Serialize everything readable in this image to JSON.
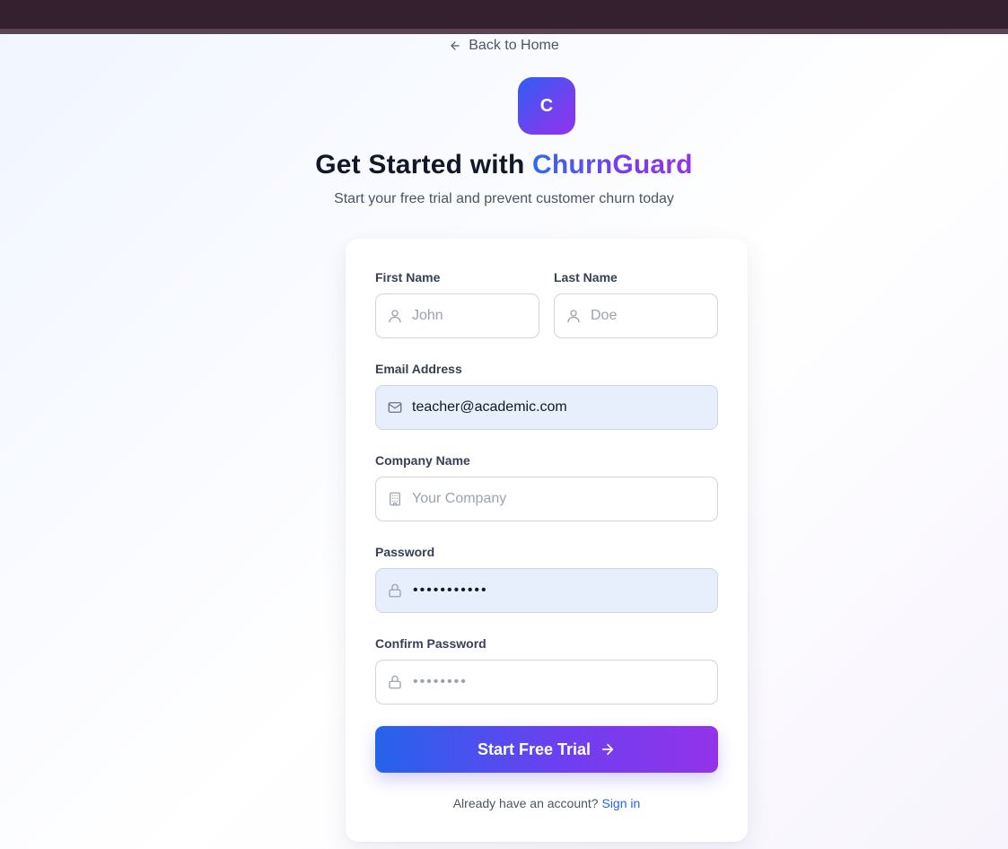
{
  "nav": {
    "back_label": "Back to Home"
  },
  "logo": {
    "letter": "C"
  },
  "header": {
    "title_prefix": "Get Started with",
    "brand": "ChurnGuard",
    "subtitle": "Start your free trial and prevent customer churn today"
  },
  "form": {
    "first_name": {
      "label": "First Name",
      "placeholder": "John",
      "value": ""
    },
    "last_name": {
      "label": "Last Name",
      "placeholder": "Doe",
      "value": ""
    },
    "email": {
      "label": "Email Address",
      "placeholder": "",
      "value": "teacher@academic.com"
    },
    "company": {
      "label": "Company Name",
      "placeholder": "Your Company",
      "value": ""
    },
    "password": {
      "label": "Password",
      "masked": "•••••••••••"
    },
    "confirm_password": {
      "label": "Confirm Password",
      "masked_placeholder": "••••••••"
    },
    "submit_label": "Start Free Trial"
  },
  "footer": {
    "prompt": "Already have an account?",
    "signin_label": "Sign in"
  },
  "colors": {
    "accent_blue": "#2563eb",
    "accent_purple": "#9333ea",
    "topbar": "#35202f"
  }
}
